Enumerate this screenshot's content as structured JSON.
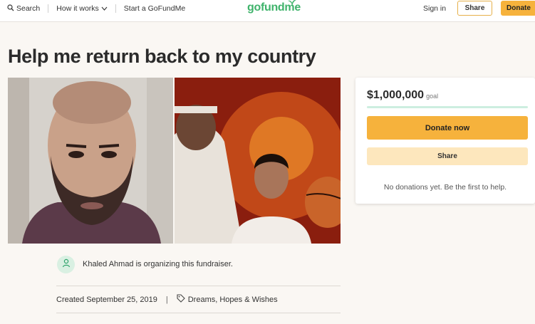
{
  "header": {
    "search_label": "Search",
    "how_it_works_label": "How it works",
    "start_label": "Start a GoFundMe",
    "logo_text": "gofundme",
    "signin_label": "Sign in",
    "share_label": "Share",
    "donate_label": "Donate"
  },
  "campaign": {
    "title": "Help me return back to my country",
    "organizer_text": "Khaled Ahmad is organizing this fundraiser.",
    "created_text": "Created September 25, 2019",
    "separator": "|",
    "category": "Dreams, Hopes & Wishes"
  },
  "donation_card": {
    "goal_amount": "$1,000,000",
    "goal_label": "goal",
    "progress_fraction": 0.0,
    "donate_now_label": "Donate now",
    "share_label": "Share",
    "no_donations_text": "No donations yet. Be the first to help."
  },
  "colors": {
    "brand_green": "#3fb36b",
    "donate_orange": "#f6b23c",
    "share_light": "#fde7bd"
  },
  "icons": [
    "search-icon",
    "chevron-down-icon",
    "organizer-icon",
    "tag-icon"
  ]
}
